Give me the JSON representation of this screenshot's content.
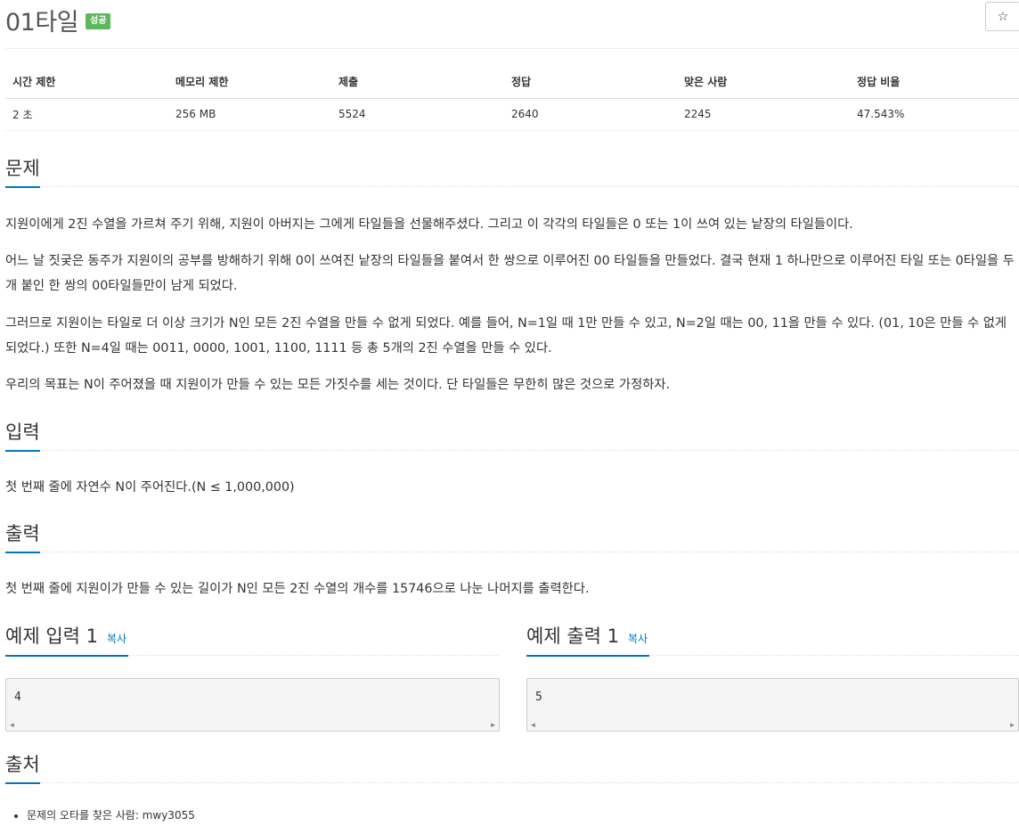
{
  "problem": {
    "title": "01타일",
    "badge": "성공"
  },
  "star_button": {
    "icon": "star-icon",
    "label": "☆"
  },
  "stats": {
    "headers": [
      "시간 제한",
      "메모리 제한",
      "제출",
      "정답",
      "맞은 사람",
      "정답 비율"
    ],
    "values": [
      "2 초",
      "256 MB",
      "5524",
      "2640",
      "2245",
      "47.543%"
    ]
  },
  "description": {
    "heading": "문제",
    "paragraphs": [
      "지원이에게 2진 수열을 가르쳐 주기 위해, 지원이 아버지는 그에게 타일들을 선물해주셨다. 그리고 이 각각의 타일들은 0 또는 1이 쓰여 있는 낱장의 타일들이다.",
      "어느 날 짓궂은 동주가 지원이의 공부를 방해하기 위해 0이 쓰여진 낱장의 타일들을 붙여서 한 쌍으로 이루어진 00 타일들을 만들었다. 결국 현재 1 하나만으로 이루어진 타일 또는 0타일을 두 개 붙인 한 쌍의 00타일들만이 남게 되었다.",
      "그러므로 지원이는 타일로 더 이상 크기가 N인 모든 2진 수열을 만들 수 없게 되었다. 예를 들어, N=1일 때 1만 만들 수 있고, N=2일 때는 00, 11을 만들 수 있다. (01, 10은 만들 수 없게 되었다.) 또한 N=4일 때는 0011, 0000, 1001, 1100, 1111 등 총 5개의 2진 수열을 만들 수 있다.",
      "우리의 목표는 N이 주어졌을 때 지원이가 만들 수 있는 모든 가짓수를 세는 것이다. 단 타일들은 무한히 많은 것으로 가정하자."
    ]
  },
  "input": {
    "heading": "입력",
    "text": "첫 번째 줄에 자연수 N이 주어진다.(N ≤ 1,000,000)"
  },
  "output": {
    "heading": "출력",
    "text": "첫 번째 줄에 지원이가 만들 수 있는 길이가 N인 모든 2진 수열의 개수를 15746으로 나눈 나머지를 출력한다."
  },
  "samples": {
    "copy_label": "복사",
    "input": {
      "heading": "예제 입력 1",
      "value": "4"
    },
    "output": {
      "heading": "예제 출력 1",
      "value": "5"
    }
  },
  "source": {
    "heading": "출처",
    "items": [
      "문제의 오타를 찾은 사람: mwy3055"
    ]
  }
}
